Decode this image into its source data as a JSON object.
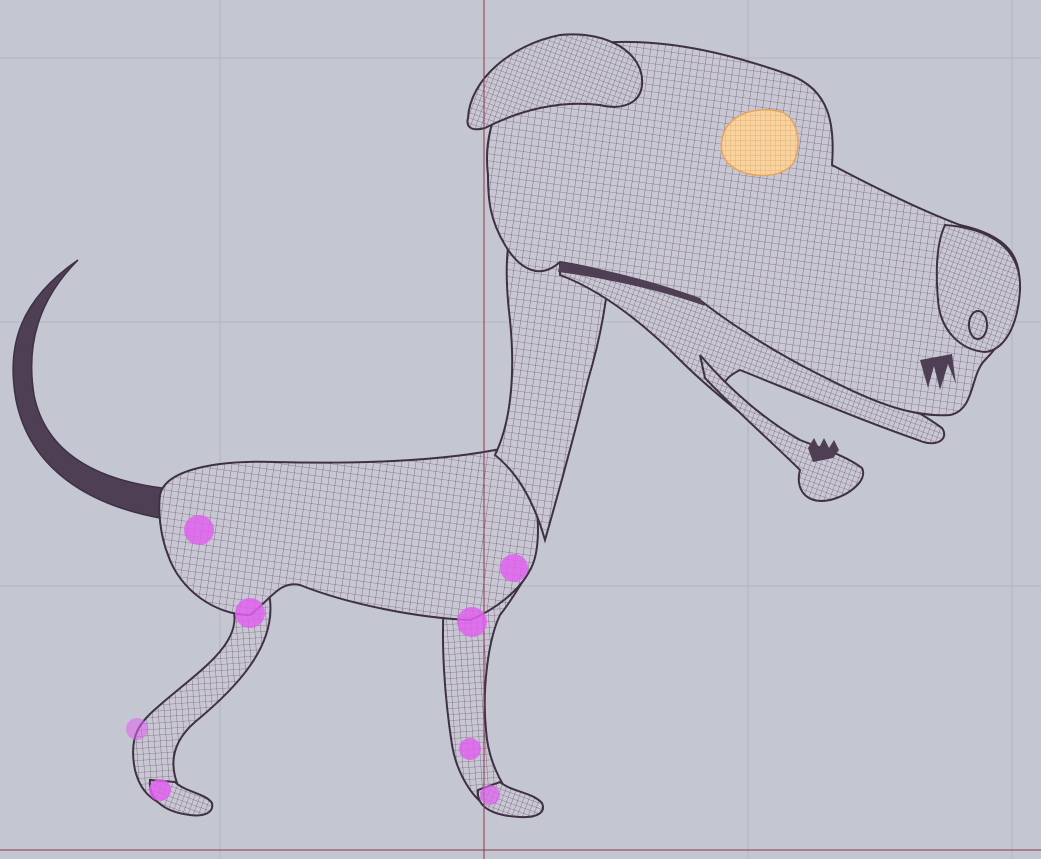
{
  "viewport": {
    "view": "side",
    "display_mode": "wireframe",
    "background_color": "#c4c7d1",
    "grid_color": "#b1b4bf",
    "axis_color": "#8a3a48",
    "wire_color": "#4f3f55",
    "mesh_fill": "#c9c7d3",
    "selected_vertex_color": "#e060ee",
    "selected_face_color": "#f3c47e"
  },
  "model": {
    "object": "dog",
    "parts": [
      "body",
      "neck",
      "head",
      "ear",
      "eye",
      "snout",
      "nose",
      "jaw",
      "tongue",
      "tail",
      "front-leg",
      "hind-leg",
      "front-paw",
      "hind-paw"
    ],
    "selected_vertex_groups": 8,
    "selected_faces": [
      "eye"
    ]
  }
}
